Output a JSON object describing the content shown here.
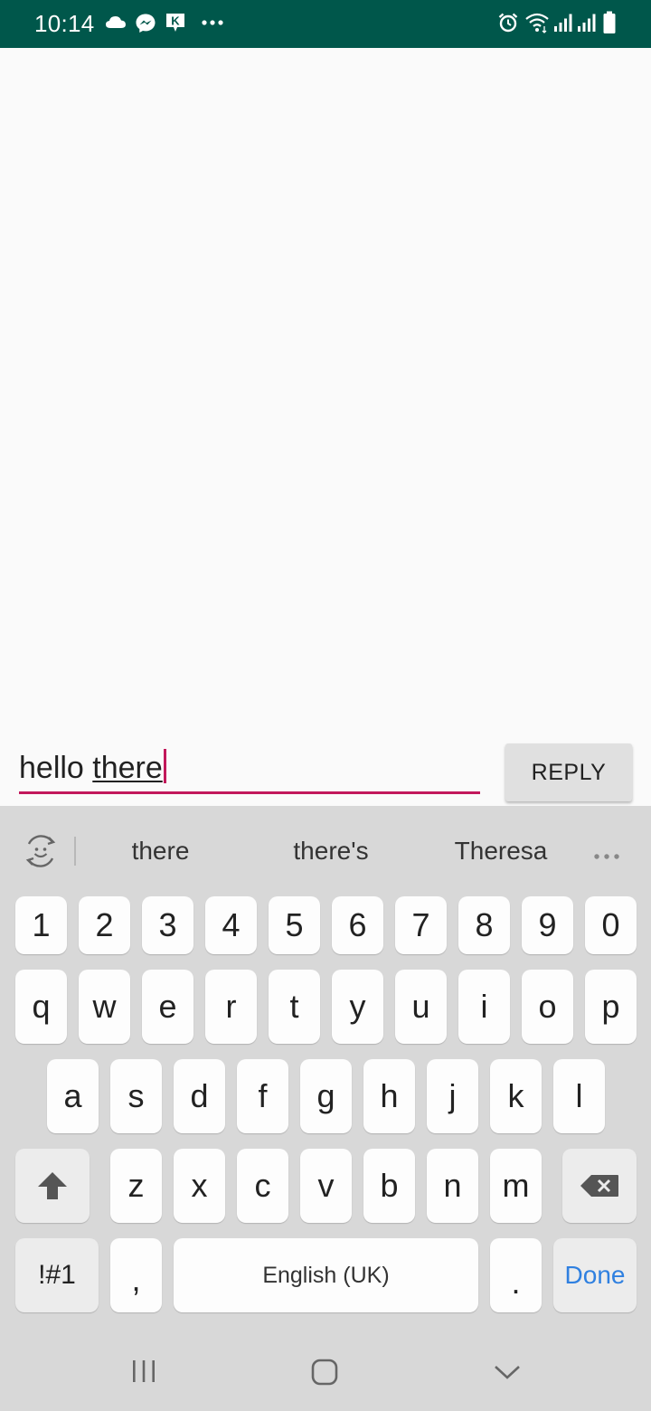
{
  "status_bar": {
    "time": "10:14",
    "left_icons": [
      "cloud-icon",
      "messenger-icon",
      "kik-icon",
      "more-notifications-icon"
    ],
    "right_icons": [
      "alarm-icon",
      "wifi-icon",
      "signal-icon",
      "signal-icon",
      "battery-icon"
    ]
  },
  "reply": {
    "typed_text": "hello ",
    "composing_word": "there",
    "button_label": "REPLY",
    "accent_color": "#c2185b"
  },
  "keyboard": {
    "suggestions": [
      "there",
      "there's",
      "Theresa"
    ],
    "number_row": [
      "1",
      "2",
      "3",
      "4",
      "5",
      "6",
      "7",
      "8",
      "9",
      "0"
    ],
    "row1": [
      "q",
      "w",
      "e",
      "r",
      "t",
      "y",
      "u",
      "i",
      "o",
      "p"
    ],
    "row2": [
      "a",
      "s",
      "d",
      "f",
      "g",
      "h",
      "j",
      "k",
      "l"
    ],
    "row3": [
      "z",
      "x",
      "c",
      "v",
      "b",
      "n",
      "m"
    ],
    "symbols_label": "!#1",
    "comma": ",",
    "space_label": "English (UK)",
    "period": ".",
    "done_label": "Done",
    "done_color": "#2f80e0"
  },
  "nav_bar": {
    "buttons": [
      "recent-apps-icon",
      "home-icon",
      "back-icon"
    ]
  },
  "colors": {
    "status_bar": "#00574b",
    "background": "#fafafa",
    "keyboard": "#d8d8d8"
  }
}
